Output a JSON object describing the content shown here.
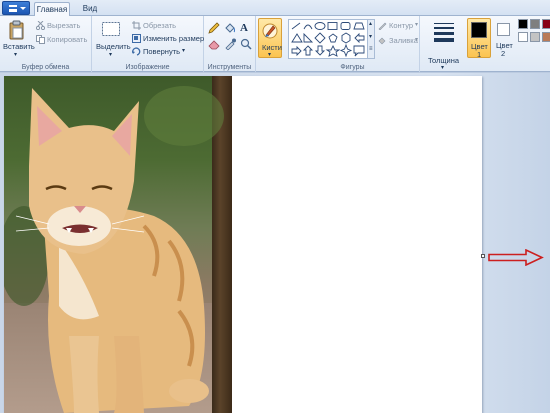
{
  "tabs": {
    "home": "Главная",
    "view": "Вид"
  },
  "clipboard": {
    "group": "Буфер обмена",
    "paste": "Вставить",
    "cut": "Вырезать",
    "copy": "Копировать"
  },
  "image": {
    "group": "Изображение",
    "select": "Выделить",
    "crop": "Обрезать",
    "resize": "Изменить размер",
    "rotate": "Повернуть"
  },
  "tools": {
    "group": "Инструменты"
  },
  "brushes": {
    "label": "Кисти"
  },
  "shapes": {
    "group": "Фигуры",
    "outline": "Контур",
    "fill": "Заливка"
  },
  "thickness": {
    "label": "Толщина"
  },
  "colors": {
    "color1_label": "Цвет",
    "color1_num": "1",
    "color2_label": "Цвет",
    "color2_num": "2",
    "color1": "#000000",
    "color2": "#ffffff",
    "palette": [
      "#000000",
      "#7f7f7f",
      "#880015",
      "#ffffff",
      "#c3c3c3",
      "#b97a57"
    ]
  },
  "canvas": {
    "resize_arrow_color": "#cc1f1f"
  }
}
